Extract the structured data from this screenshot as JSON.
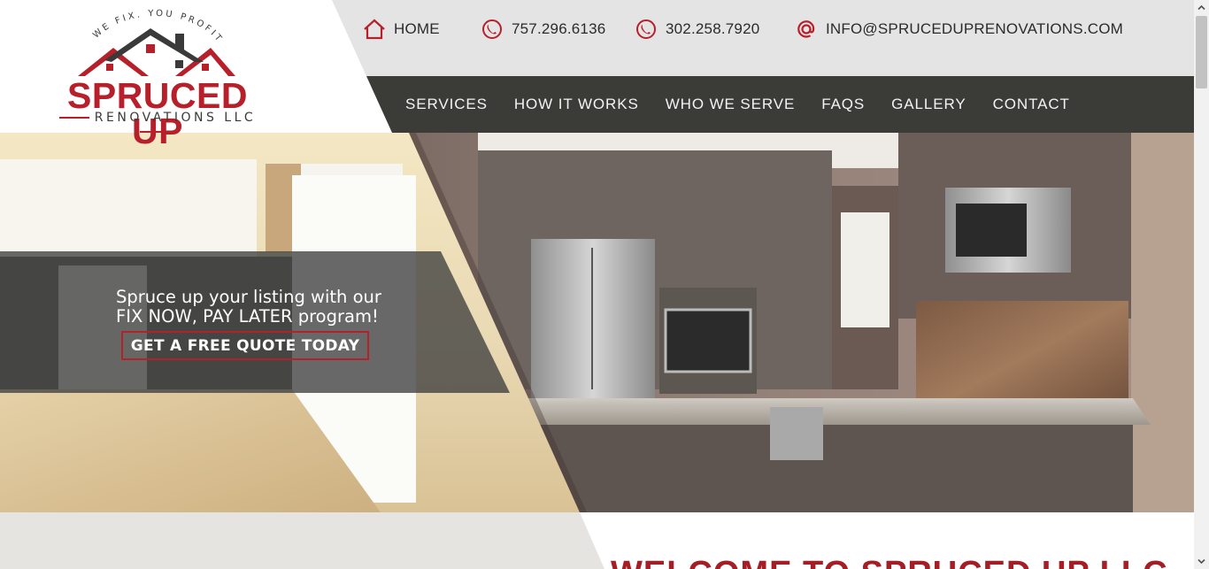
{
  "header": {
    "home_label": "HOME",
    "phone1": "757.296.6136",
    "phone2": "302.258.7920",
    "email": "INFO@SPRUCEDUPRENOVATIONS.COM"
  },
  "logo": {
    "tagline": "WE FIX. YOU PROFIT.",
    "wordmark": "SPRUCED UP",
    "subtitle": "RENOVATIONS LLC"
  },
  "nav": {
    "items": [
      "SERVICES",
      "HOW IT WORKS",
      "WHO WE SERVE",
      "FAQS",
      "GALLERY",
      "CONTACT"
    ]
  },
  "hero": {
    "line1": "Spruce up your listing with our",
    "line2": "FIX NOW, PAY LATER program!",
    "cta_label": "GET A FREE QUOTE TODAY"
  },
  "welcome": {
    "heading": "WELCOME TO SPRUCED UP LLC"
  },
  "colors": {
    "brand_red": "#b7202a",
    "nav_bg": "#3b3c37",
    "topbar_bg": "#e4e4e4"
  },
  "icons": {
    "home": "home-icon",
    "phone": "phone-icon",
    "email": "at-icon"
  }
}
